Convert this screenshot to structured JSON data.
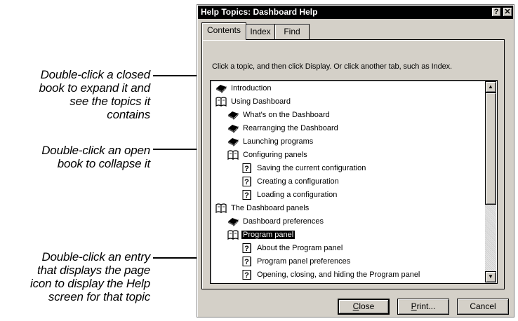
{
  "callouts": {
    "closed_book": [
      "Double-click a closed",
      "book to expand it and",
      "see the topics it",
      "contains"
    ],
    "open_book": [
      "Double-click an open",
      "book to collapse it"
    ],
    "page_entry": [
      "Double-click an entry",
      "that displays the page",
      "icon to display the Help",
      "screen for that topic"
    ]
  },
  "window": {
    "title": "Help Topics: Dashboard Help",
    "help_button": "?",
    "close_button": "✕"
  },
  "tabs": [
    {
      "label": "Contents",
      "active": true
    },
    {
      "label": "Index",
      "active": false
    },
    {
      "label": "Find",
      "active": false
    }
  ],
  "instructions": "Click a topic, and then click Display. Or click another tab, such as Index.",
  "tree": [
    {
      "label": "Introduction",
      "icon": "closed-book-icon",
      "level": 0
    },
    {
      "label": "Using Dashboard",
      "icon": "open-book-icon",
      "level": 0
    },
    {
      "label": "What's on the Dashboard",
      "icon": "closed-book-icon",
      "level": 1
    },
    {
      "label": "Rearranging the Dashboard",
      "icon": "closed-book-icon",
      "level": 1
    },
    {
      "label": "Launching programs",
      "icon": "closed-book-icon",
      "level": 1
    },
    {
      "label": "Configuring panels",
      "icon": "open-book-icon",
      "level": 1
    },
    {
      "label": "Saving the current configuration",
      "icon": "page-icon",
      "level": 2
    },
    {
      "label": "Creating a configuration",
      "icon": "page-icon",
      "level": 2
    },
    {
      "label": "Loading a configuration",
      "icon": "page-icon",
      "level": 2
    },
    {
      "label": "The Dashboard panels",
      "icon": "open-book-icon",
      "level": 0
    },
    {
      "label": "Dashboard preferences",
      "icon": "closed-book-icon",
      "level": 1
    },
    {
      "label": "Program panel",
      "icon": "open-book-icon",
      "level": 1,
      "selected": true
    },
    {
      "label": "About the Program panel",
      "icon": "page-icon",
      "level": 2
    },
    {
      "label": "Program panel preferences",
      "icon": "page-icon",
      "level": 2
    },
    {
      "label": "Opening, closing, and hiding the Program panel",
      "icon": "page-icon",
      "level": 2
    }
  ],
  "buttons": {
    "close": {
      "label": "Close",
      "accel": "C",
      "rest": "lose"
    },
    "print": {
      "label": "Print...",
      "accel": "P",
      "rest": "rint..."
    },
    "cancel": {
      "label": "Cancel"
    }
  },
  "scrollbar": {
    "up": "▲",
    "down": "▼"
  }
}
